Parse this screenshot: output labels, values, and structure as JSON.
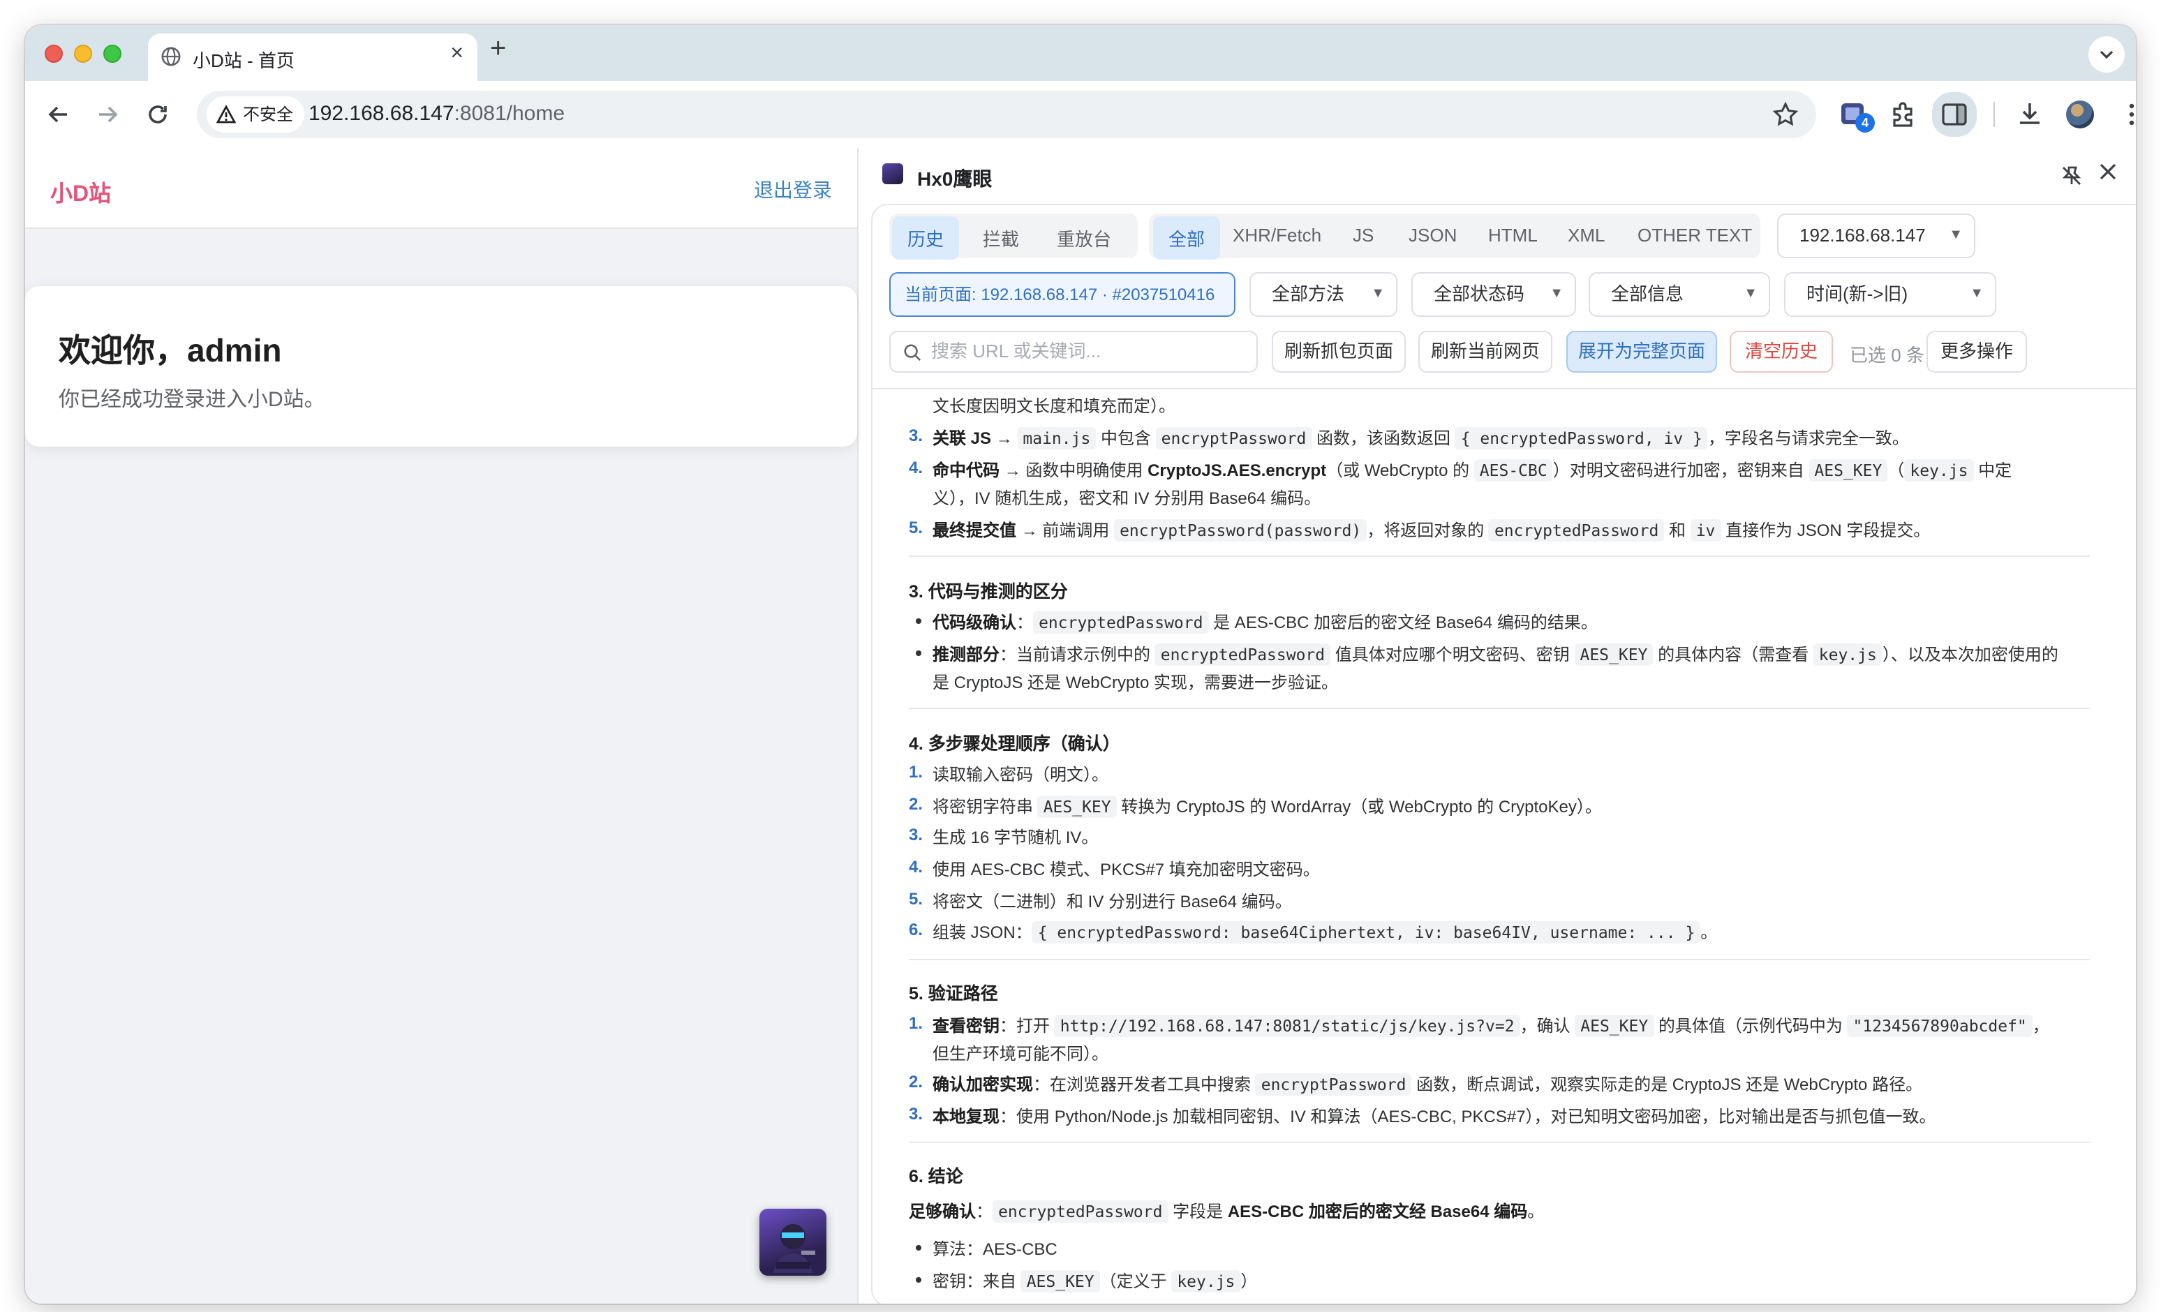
{
  "tab": {
    "title": "小D站 - 首页",
    "close": "×",
    "new": "+"
  },
  "address": {
    "security_label": "不安全",
    "url_host": "192.168.68.147",
    "url_rest": ":8081/home"
  },
  "extensions": {
    "badge_count": "4"
  },
  "site": {
    "logo": "小D站",
    "logout": "退出登录",
    "welcome_title": "欢迎你，admin",
    "welcome_subtitle": "你已经成功登录进入小D站。"
  },
  "panel": {
    "title": "Hx0鹰眼",
    "left_tabs": [
      "历史",
      "拦截",
      "重放台"
    ],
    "type_tabs": [
      "全部",
      "XHR/Fetch",
      "JS",
      "JSON",
      "HTML",
      "XML",
      "OTHER TEXT"
    ],
    "host_select": "192.168.68.147",
    "current_page_chip": "当前页面: 192.168.68.147 · #2037510416",
    "method_select": "全部方法",
    "status_select": "全部状态码",
    "info_select": "全部信息",
    "sort_select": "时间(新->旧)",
    "search_placeholder": "搜索 URL 或关键词...",
    "btn_refresh_capture": "刷新抓包页面",
    "btn_refresh_current": "刷新当前网页",
    "btn_expand": "展开为完整页面",
    "btn_clear": "清空历史",
    "selected_count": "已选 0 条",
    "btn_more": "更多操作"
  },
  "report": {
    "l0": "文长度因明文长度和填充而定）。",
    "s2": [
      {
        "n": "3.",
        "b": "关联 JS",
        "t1": " → ",
        "c1": "main.js",
        "t2": " 中包含 ",
        "c2": "encryptPassword",
        "t3": " 函数，该函数返回 ",
        "c3": "{ encryptedPassword, iv }",
        "t4": "，字段名与请求完全一致。"
      },
      {
        "n": "4.",
        "b": "命中代码",
        "t1": " → 函数中明确使用 ",
        "b2": "CryptoJS.AES.encrypt",
        "t2": "（或 WebCrypto 的 ",
        "c1": "AES-CBC",
        "t3": "）对明文密码进行加密，密钥来自 ",
        "c2": "AES_KEY",
        "t4": "（",
        "c3": "key.js",
        "t5": " 中定"
      },
      {
        "cont": "义），IV 随机生成，密文和 IV 分别用 Base64 编码。"
      },
      {
        "n": "5.",
        "b": "最终提交值",
        "t1": " → 前端调用 ",
        "c1": "encryptPassword(password)",
        "t2": "，将返回对象的 ",
        "c2": "encryptedPassword",
        "t3": " 和 ",
        "c3": "iv",
        "t4": " 直接作为 JSON 字段提交。"
      }
    ],
    "h3": "3. 代码与推测的区分",
    "s3a": {
      "b": "代码级确认",
      "t1": "：",
      "c1": "encryptedPassword",
      "t2": " 是 AES-CBC 加密后的密文经 Base64 编码的结果。"
    },
    "s3b": {
      "b": "推测部分",
      "t1": "：当前请求示例中的 ",
      "c1": "encryptedPassword",
      "t2": " 值具体对应哪个明文密码、密钥 ",
      "c2": "AES_KEY",
      "t3": " 的具体内容（需查看 ",
      "c3": "key.js",
      "t4": "）、以及本次加密使用的",
      "cont": "是 CryptoJS 还是 WebCrypto 实现，需要进一步验证。"
    },
    "h4": "4. 多步骤处理顺序（确认）",
    "s4": [
      {
        "n": "1.",
        "t": "读取输入密码（明文）。"
      },
      {
        "n": "2.",
        "t1": "将密钥字符串 ",
        "c1": "AES_KEY",
        "t2": " 转换为 CryptoJS 的 WordArray（或 WebCrypto 的 CryptoKey）。"
      },
      {
        "n": "3.",
        "t": "生成 16 字节随机 IV。"
      },
      {
        "n": "4.",
        "t": "使用 AES-CBC 模式、PKCS#7 填充加密明文密码。"
      },
      {
        "n": "5.",
        "t": "将密文（二进制）和 IV 分别进行 Base64 编码。"
      },
      {
        "n": "6.",
        "t1": "组装 JSON：",
        "c1": "{ encryptedPassword: base64Ciphertext, iv: base64IV, username: ... }",
        "t2": "。"
      }
    ],
    "h5": "5. 验证路径",
    "s5": [
      {
        "n": "1.",
        "b": "查看密钥",
        "t1": "：打开 ",
        "c1": "http://192.168.68.147:8081/static/js/key.js?v=2",
        "t2": "，确认 ",
        "c2": "AES_KEY",
        "t3": " 的具体值（示例代码中为 ",
        "c3": "\"1234567890abcdef\"",
        "t4": "，",
        "cont": "但生产环境可能不同）。"
      },
      {
        "n": "2.",
        "b": "确认加密实现",
        "t1": "：在浏览器开发者工具中搜索 ",
        "c1": "encryptPassword",
        "t2": " 函数，断点调试，观察实际走的是 CryptoJS 还是 WebCrypto 路径。"
      },
      {
        "n": "3.",
        "b": "本地复现",
        "t1": "：使用 Python/Node.js 加载相同密钥、IV 和算法（AES-CBC, PKCS#7），对已知明文密码加密，比对输出是否与抓包值一致。"
      }
    ],
    "h6": "6. 结论",
    "s6": {
      "b1": "足够确认",
      "t1": "：",
      "c1": "encryptedPassword",
      "t2": " 字段是 ",
      "b2": "AES-CBC 加密后的密文经 Base64 编码",
      "t3": "。"
    },
    "s6a": "算法：AES-CBC",
    "s6b": {
      "t1": "密钥：来自 ",
      "c1": "AES_KEY",
      "t2": "（定义于 ",
      "c2": "key.js",
      "t3": "）"
    }
  }
}
